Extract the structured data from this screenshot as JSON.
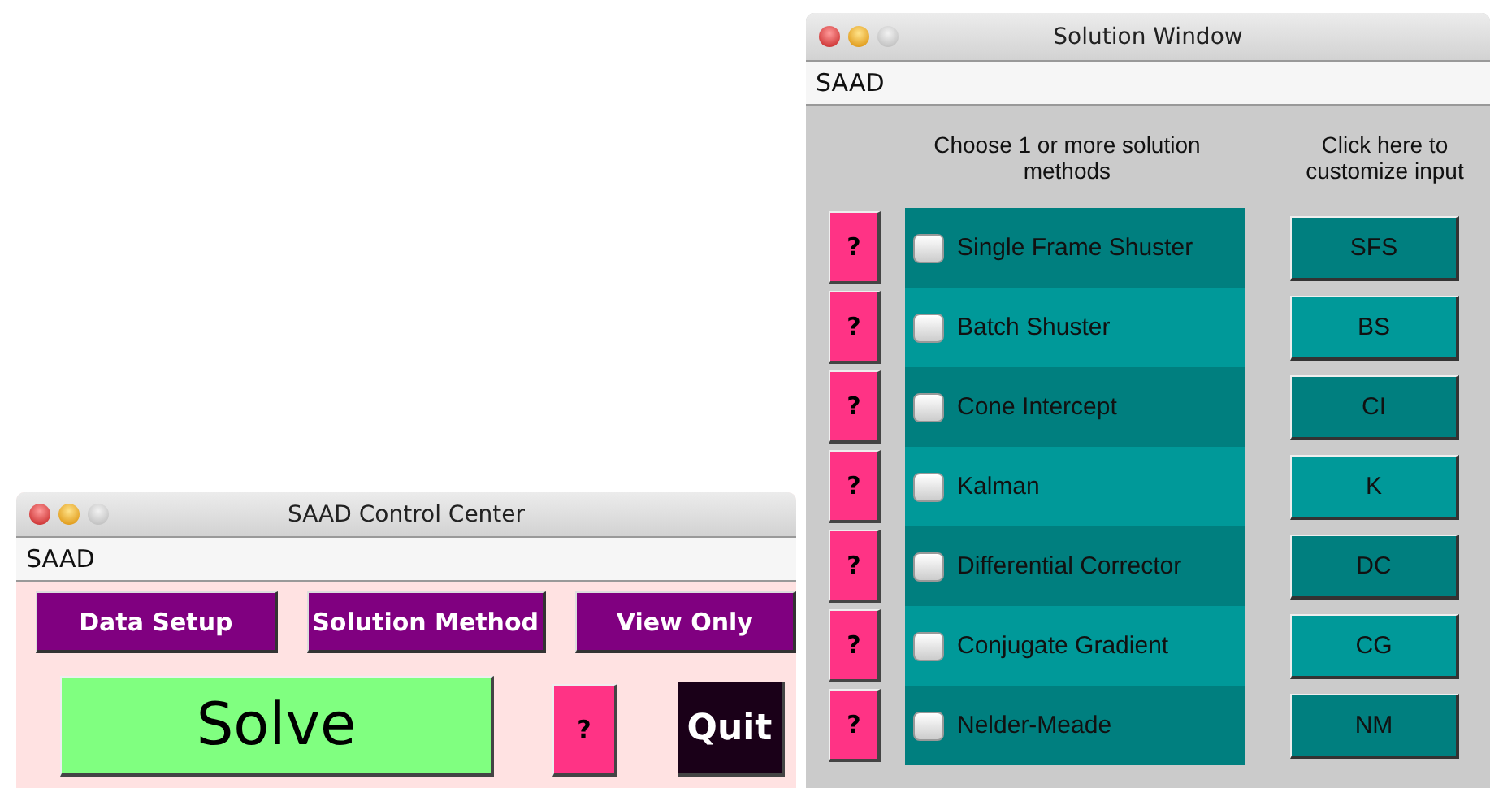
{
  "control_window": {
    "title": "SAAD Control Center",
    "menu": "SAAD",
    "nav_buttons": [
      "Data Setup",
      "Solution Method",
      "View Only"
    ],
    "solve_button": "Solve",
    "help_button": "?",
    "quit_button": "Quit"
  },
  "solution_window": {
    "title": "Solution Window",
    "menu": "SAAD",
    "methods_header": "Choose 1 or more solution methods",
    "inputs_header": "Click here to customize input",
    "methods": [
      {
        "help": "?",
        "label": "Single Frame Shuster",
        "checked": false,
        "button": "SFS"
      },
      {
        "help": "?",
        "label": "Batch Shuster",
        "checked": false,
        "button": "BS"
      },
      {
        "help": "?",
        "label": "Cone Intercept",
        "checked": false,
        "button": "CI"
      },
      {
        "help": "?",
        "label": "Kalman",
        "checked": false,
        "button": "K"
      },
      {
        "help": "?",
        "label": "Differential Corrector",
        "checked": false,
        "button": "DC"
      },
      {
        "help": "?",
        "label": "Conjugate Gradient",
        "checked": false,
        "button": "CG"
      },
      {
        "help": "?",
        "label": "Nelder-Meade",
        "checked": false,
        "button": "NM"
      }
    ]
  }
}
